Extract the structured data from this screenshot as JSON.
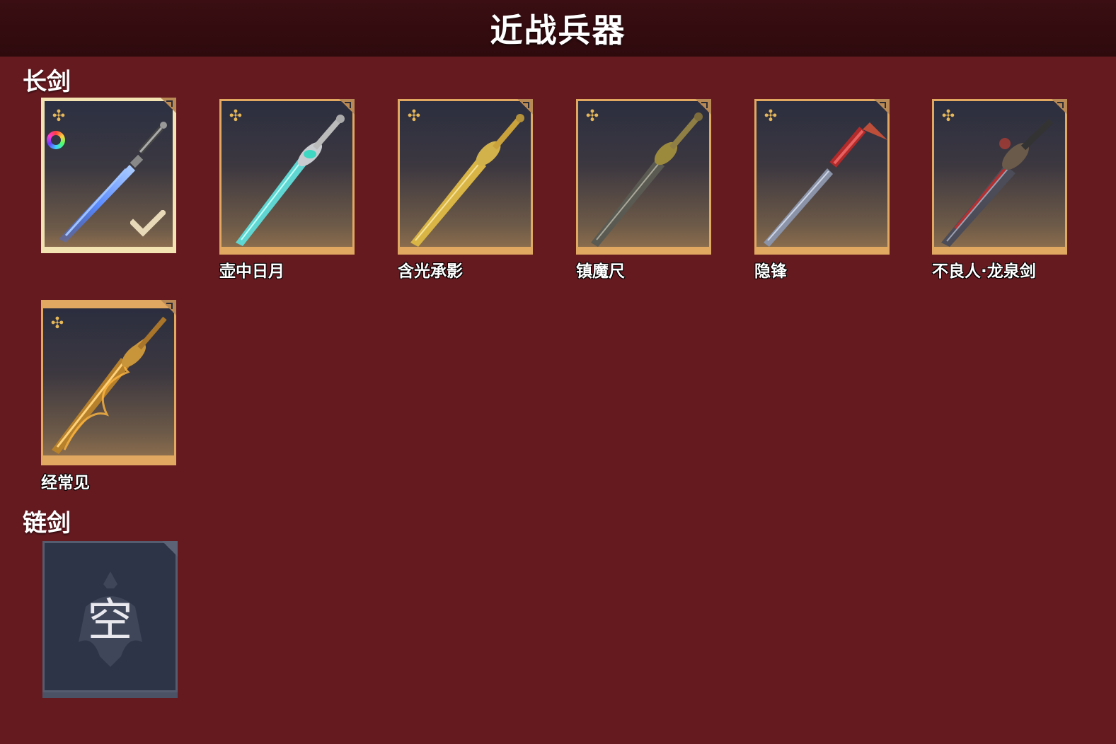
{
  "colors": {
    "background": "#651a20",
    "header": "#330b0e",
    "frame_gold": "#e0a860",
    "selected_frame": "#f3e3b3"
  },
  "header": {
    "title": "近战兵器"
  },
  "sections": [
    {
      "title": "长剑"
    },
    {
      "title": "链剑"
    }
  ],
  "longsword": {
    "items": [
      {
        "name": "",
        "selected": true,
        "icon": "blue-sword"
      },
      {
        "name": "壶中日月",
        "icon": "cyan-sword"
      },
      {
        "name": "含光承影",
        "icon": "golden-sword"
      },
      {
        "name": "镇魔尺",
        "icon": "dark-sword"
      },
      {
        "name": "隐锋",
        "icon": "red-hilt-sword"
      },
      {
        "name": "不良人·龙泉剑",
        "icon": "dragon-sword"
      },
      {
        "name": "经常见",
        "icon": "flaming-gold-sword"
      }
    ]
  },
  "chainsword": {
    "empty_label": "空"
  }
}
